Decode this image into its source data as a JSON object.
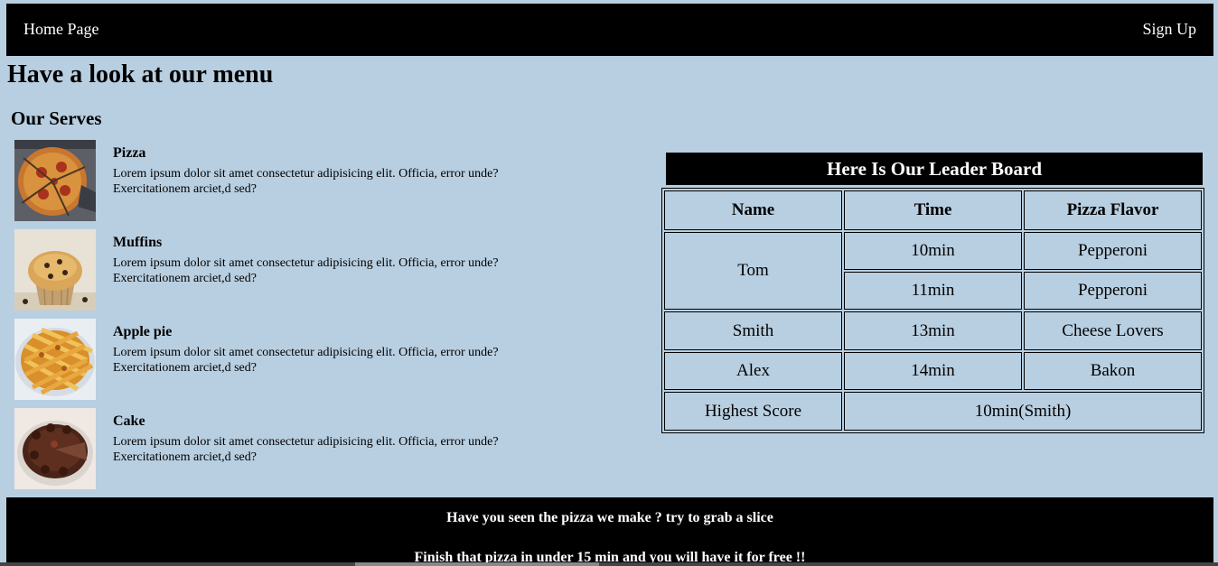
{
  "nav": {
    "home": "Home Page",
    "signup": "Sign Up"
  },
  "page_title": "Have a look at our menu",
  "section_title": "Our Serves",
  "menu": [
    {
      "name": "Pizza",
      "desc": "Lorem ipsum dolor sit amet consectetur adipisicing elit. Officia, error unde? Exercitationem arciet,d sed?",
      "image": "pizza-image"
    },
    {
      "name": "Muffins",
      "desc": "Lorem ipsum dolor sit amet consectetur adipisicing elit. Officia, error unde? Exercitationem arciet,d sed?",
      "image": "muffin-image"
    },
    {
      "name": "Apple pie",
      "desc": "Lorem ipsum dolor sit amet consectetur adipisicing elit. Officia, error unde? Exercitationem arciet,d sed?",
      "image": "apple-pie-image"
    },
    {
      "name": "Cake",
      "desc": "Lorem ipsum dolor sit amet consectetur adipisicing elit. Officia, error unde? Exercitationem arciet,d sed?",
      "image": "cake-image"
    }
  ],
  "leaderboard": {
    "title": "Here Is Our Leader Board",
    "headers": [
      "Name",
      "Time",
      "Pizza Flavor"
    ],
    "rows": [
      {
        "name": "Tom",
        "entries": [
          {
            "time": "10min",
            "flavor": "Pepperoni"
          },
          {
            "time": "11min",
            "flavor": "Pepperoni"
          }
        ]
      },
      {
        "name": "Smith",
        "entries": [
          {
            "time": "13min",
            "flavor": "Cheese Lovers"
          }
        ]
      },
      {
        "name": "Alex",
        "entries": [
          {
            "time": "14min",
            "flavor": "Bakon"
          }
        ]
      }
    ],
    "highest": {
      "label": "Highest Score",
      "value": "10min(Smith)"
    }
  },
  "footer": {
    "line1": "Have you seen the pizza we make ? try to grab a slice",
    "line2": "Finish that pizza in under 15 min and you will have it for free !!"
  },
  "colors": {
    "background": "#b8cfe1",
    "bar": "#000000",
    "bar_text": "#ffffff"
  }
}
